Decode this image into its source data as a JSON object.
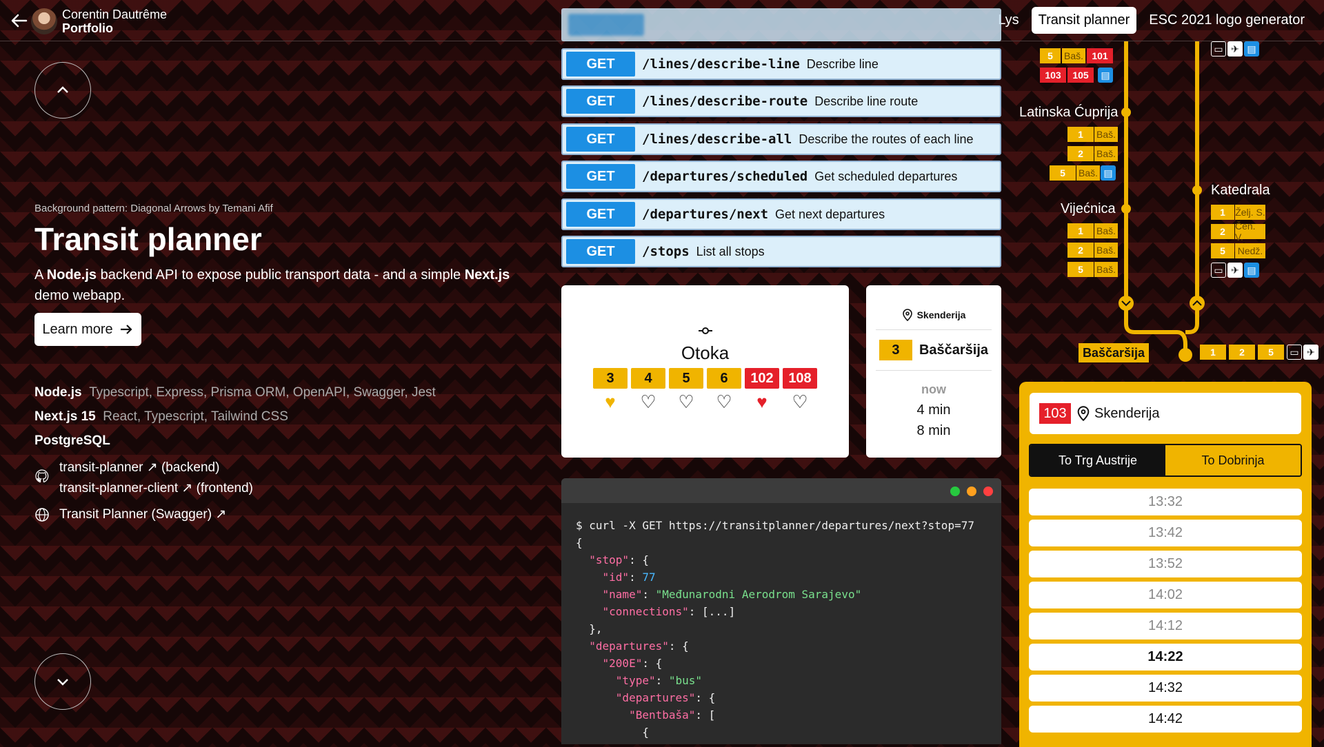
{
  "header": {
    "name": "Corentin Dautrême",
    "subtitle": "Portfolio",
    "nav": [
      "Lys",
      "Transit planner",
      "ESC 2021 logo generator"
    ]
  },
  "left": {
    "bg_note_prefix": "Background pattern: ",
    "bg_note_link": "Diagonal Arrows by Temani Afif",
    "title": "Transit planner",
    "desc_parts": [
      "A ",
      "Node.js",
      " backend API to expose public transport data - and a simple ",
      "Next.js",
      " demo webapp."
    ],
    "learn_more": "Learn more",
    "stack": [
      {
        "name": "Node.js",
        "extra": "Typescript, Express, Prisma ORM, OpenAPI, Swagger, Jest"
      },
      {
        "name": "Next.js 15",
        "extra": "React, Typescript, Tailwind CSS"
      },
      {
        "name": "PostgreSQL",
        "extra": ""
      }
    ],
    "repo_backend": "transit-planner",
    "repo_backend_note": "(backend)",
    "repo_frontend": "transit-planner-client",
    "repo_frontend_note": "(frontend)",
    "swagger": "Transit Planner (Swagger)"
  },
  "api": [
    {
      "method": "GET",
      "path": "/lines/describe-line",
      "desc": "Describe line"
    },
    {
      "method": "GET",
      "path": "/lines/describe-route",
      "desc": "Describe line route"
    },
    {
      "method": "GET",
      "path": "/lines/describe-all",
      "desc": "Describe the routes of each line"
    },
    {
      "method": "GET",
      "path": "/departures/scheduled",
      "desc": "Get scheduled departures"
    },
    {
      "method": "GET",
      "path": "/departures/next",
      "desc": "Get next departures"
    },
    {
      "method": "GET",
      "path": "/stops",
      "desc": "List all stops"
    }
  ],
  "stop_card": {
    "name": "Otoka",
    "lines": [
      "3",
      "4",
      "5",
      "6",
      "102",
      "108"
    ]
  },
  "departure_card": {
    "stop": "Skenderija",
    "line": "3",
    "dest": "Baščaršija",
    "now": "now",
    "times": [
      "4 min",
      "8 min"
    ]
  },
  "terminal": {
    "cmd": "$ curl -X GET https://transitplanner/departures/next?stop=77",
    "stop_id": "77",
    "stop_name": "\"Međunarodni Aerodrom Sarajevo\"",
    "line_key": "\"200E\"",
    "type_val": "\"bus\"",
    "dest_key": "\"Bentbaša\""
  },
  "map": {
    "stop_latinska": "Latinska Ćuprija",
    "stop_vijecnica": "Vijećnica",
    "stop_katedrala": "Katedrala",
    "stop_bascarsija": "Baščaršija",
    "top_row1": [
      "5",
      "Baš.",
      "101"
    ],
    "top_row2": [
      "103",
      "105"
    ],
    "lat_rows": [
      [
        "1",
        "Baš."
      ],
      [
        "2",
        "Baš."
      ],
      [
        "5",
        "Baš."
      ]
    ],
    "vij_rows": [
      [
        "1",
        "Baš."
      ],
      [
        "2",
        "Baš."
      ],
      [
        "5",
        "Baš."
      ]
    ],
    "kat_rows": [
      [
        "1",
        "Želj. S."
      ],
      [
        "2",
        "Čen. V."
      ],
      [
        "5",
        "Nedž."
      ]
    ],
    "bas_lines": [
      "1",
      "2",
      "5"
    ]
  },
  "timetable": {
    "line": "103",
    "stop": "Skenderija",
    "tab_a": "To Trg Austrije",
    "tab_b": "To Dobrinja",
    "times": [
      "13:32",
      "13:42",
      "13:52",
      "14:02",
      "14:12",
      "14:22",
      "14:32",
      "14:42"
    ],
    "current_index": 5
  },
  "colors": {
    "accent": "#f0b400",
    "api_blue": "#1c8fe3",
    "red": "#e5202a"
  }
}
